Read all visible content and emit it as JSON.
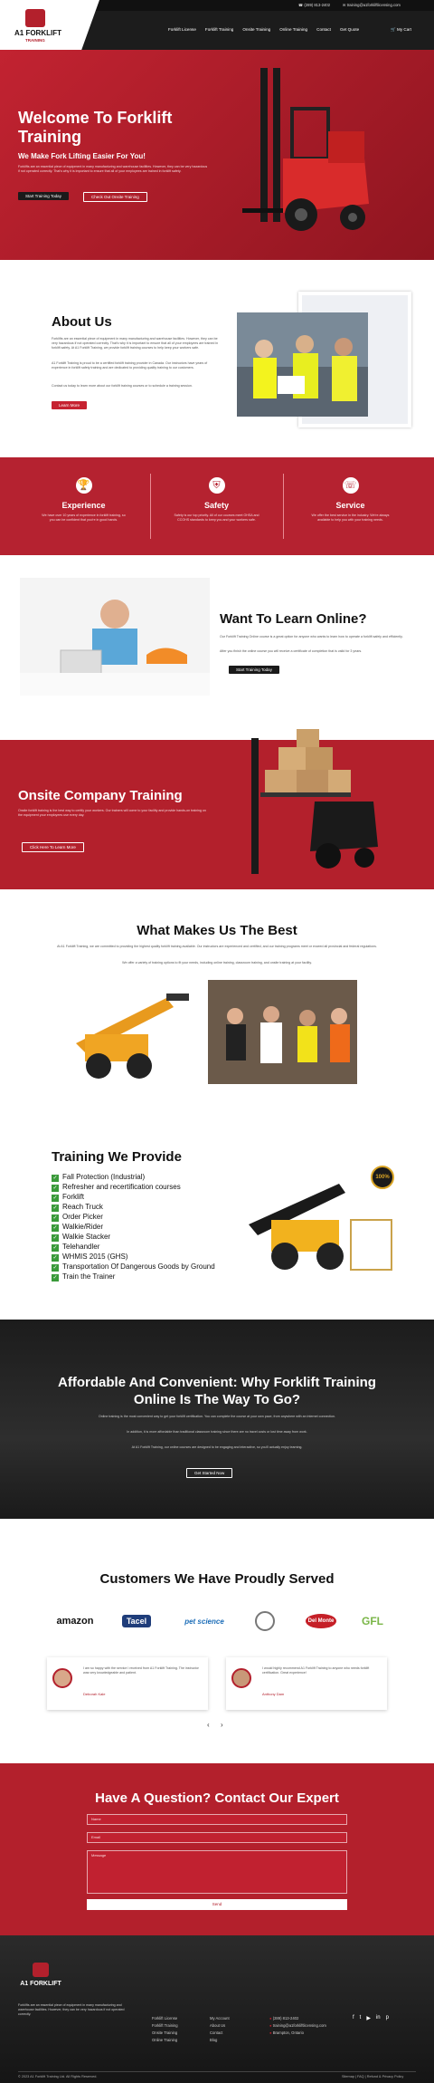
{
  "topbar": {
    "phone": "(289) 813-2402",
    "email": "training@a1forkliftlicensing.com",
    "phone_icon": "phone-icon",
    "mail_icon": "mail-icon"
  },
  "header": {
    "logo_text": "A1 FORKLIFT",
    "logo_sub": "TRAINING",
    "nav": [
      "Forklift License",
      "Forklift Training",
      "Onsite Training",
      "Online Training",
      "Contact",
      "Get Quote"
    ],
    "cart": "My Cart"
  },
  "hero": {
    "title": "Welcome To Forklift Training",
    "subtitle": "We Make Fork Lifting Easier For You!",
    "text": "Forklifts are an essential piece of equipment in many manufacturing and warehouse facilities. However, they can be very hazardous if not operated correctly. That's why it is important to ensure that all of your employees are trained in forklift safety.",
    "btn_primary": "Start Training Today",
    "btn_secondary": "Check Out Onsite Training"
  },
  "about": {
    "title": "About Us",
    "p1": "Forklifts are an essential piece of equipment in many manufacturing and warehouse facilities. However, they can be very hazardous if not operated correctly. That's why it is important to ensure that all of your employees are trained in forklift safety. At A1 Forklift Training, we provide forklift training courses to help keep your workers safe.",
    "p2": "A1 Forklift Training is proud to be a certified forklift training provider in Canada. Our instructors have years of experience in forklift safety training and are dedicated to providing quality training to our customers.",
    "p3": "Contact us today to learn more about our forklift training courses or to schedule a training session.",
    "btn": "Learn More"
  },
  "features": [
    {
      "title": "Experience",
      "icon": "trophy-icon",
      "text": "We have over 10 years of experience in forklift training, so you can be confident that you're in good hands."
    },
    {
      "title": "Safety",
      "icon": "shield-icon",
      "text": "Safety is our top priority. All of our courses meet OHSA and CCOHS standards to keep you and your workers safe."
    },
    {
      "title": "Service",
      "icon": "support-icon",
      "text": "We offer the best service in the industry. We're always available to help you with your training needs."
    }
  ],
  "online": {
    "title": "Want To Learn Online?",
    "p1": "Our Forklift Training Online course is a great option for anyone who wants to learn how to operate a forklift safely and efficiently.",
    "p2": "After you finish the online course you will receive a certificate of completion that is valid for 3 years.",
    "btn": "Start Training Today"
  },
  "onsite": {
    "title": "Onsite Company Training",
    "text": "Onsite forklift training is the best way to certify your workers. Our trainers will come to your facility and provide hands-on training on the equipment your employees use every day.",
    "btn": "Click Here To Learn More"
  },
  "best": {
    "title": "What Makes Us The Best",
    "p1": "At A1 Forklift Training, we are committed to providing the highest quality forklift training available. Our instructors are experienced and certified, and our training programs meet or exceed all provincial and federal regulations.",
    "p2": "We offer a variety of training options to fit your needs, including online training, classroom training, and onsite training at your facility."
  },
  "provide": {
    "title": "Training We Provide",
    "items": [
      "Fall Protection (Industrial)",
      "Refresher and recertification courses",
      "Forklift",
      "Reach Truck",
      "Order Picker",
      "Walkie/Rider",
      "Walkie Stacker",
      "Telehandler",
      "WHMIS 2015 (GHS)",
      "Transportation Of Dangerous Goods by Ground",
      "Train the Trainer"
    ],
    "badge": "100%"
  },
  "affordable": {
    "title": "Affordable And Convenient: Why Forklift Training Online Is The Way To Go?",
    "p1": "Online training is the most convenient way to get your forklift certification. You can complete the course at your own pace, from anywhere with an internet connection.",
    "p2": "In addition, it is more affordable than traditional classroom training since there are no travel costs or lost time away from work.",
    "p3": "At A1 Forklift Training, our online courses are designed to be engaging and interactive, so you'll actually enjoy learning.",
    "btn": "Get Started Now"
  },
  "customers": {
    "title": "Customers We Have Proudly Served",
    "logos": [
      "amazon",
      "Tacel",
      "pet science",
      "seal",
      "Del Monte",
      "GFL"
    ]
  },
  "testimonials": [
    {
      "text": "I am so happy with the service I received from A1 Forklift Training. The instructor was very knowledgeable and patient.",
      "name": "Deborah Kale"
    },
    {
      "text": "I would highly recommend A1 Forklift Training to anyone who needs forklift certification. Great experience!",
      "name": "Anthony Dam"
    }
  ],
  "contact": {
    "title": "Have A Question? Contact Our Expert",
    "name_ph": "Name",
    "email_ph": "Email",
    "message_ph": "Message",
    "btn": "Send"
  },
  "footer": {
    "about": "Forklifts are an essential piece of equipment in many manufacturing and warehouse facilities. However, they can be very hazardous if not operated correctly.",
    "col1": [
      "Forklift License",
      "Forklift Training",
      "Onsite Training",
      "Online Training"
    ],
    "col2": [
      "My Account",
      "About Us",
      "Contact",
      "Blog"
    ],
    "contact": [
      "(289) 813-2402",
      "training@a1forkliftlicensing.com",
      "Brampton, Ontario"
    ],
    "copyright": "© 2023 A1 Forklift Training Ltd. All Rights Reserved.",
    "legal": "Sitemap | FAQ | Refund & Privacy Policy"
  },
  "colors": {
    "accent": "#b3202c",
    "dark": "#1c1c1c"
  }
}
